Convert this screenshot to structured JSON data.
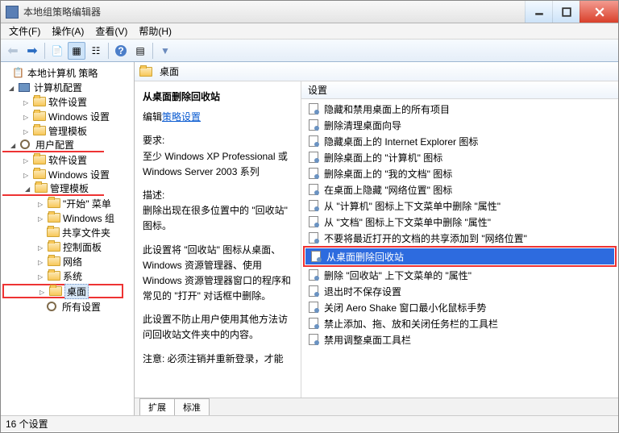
{
  "window": {
    "title": "本地组策略编辑器"
  },
  "menu": {
    "file": "文件(F)",
    "action": "操作(A)",
    "view": "查看(V)",
    "help": "帮助(H)"
  },
  "tree": {
    "root": "本地计算机 策略",
    "computer_cfg": "计算机配置",
    "c_software": "软件设置",
    "c_windows": "Windows 设置",
    "c_templates": "管理模板",
    "user_cfg": "用户配置",
    "u_software": "软件设置",
    "u_windows": "Windows 设置",
    "u_templates": "管理模板",
    "start_menu": "\"开始\" 菜单",
    "win_group": "Windows 组",
    "shared": "共享文件夹",
    "ctrl_panel": "控制面板",
    "network": "网络",
    "system": "系统",
    "desktop": "桌面",
    "all_settings": "所有设置"
  },
  "content": {
    "header": "桌面",
    "title": "从桌面删除回收站",
    "edit_prefix": "编辑",
    "edit_link": "策略设置",
    "req_label": "要求:",
    "req_text": "至少 Windows XP Professional 或 Windows Server 2003 系列",
    "desc_label": "描述:",
    "desc1": "删除出现在很多位置中的 \"回收站\" 图标。",
    "desc2": "此设置将 \"回收站\" 图标从桌面、Windows 资源管理器、使用 Windows 资源管理器窗口的程序和常见的 \"打开\" 对话框中删除。",
    "desc3": "此设置不防止用户使用其他方法访问回收站文件夹中的内容。",
    "desc4": "注意: 必须注销并重新登录，才能",
    "col_setting": "设置"
  },
  "policies": [
    "隐藏和禁用桌面上的所有项目",
    "删除清理桌面向导",
    "隐藏桌面上的 Internet Explorer 图标",
    "删除桌面上的 \"计算机\" 图标",
    "删除桌面上的 \"我的文档\" 图标",
    "在桌面上隐藏 \"网络位置\" 图标",
    "从 \"计算机\" 图标上下文菜单中删除 \"属性\"",
    "从 \"文档\" 图标上下文菜单中删除 \"属性\"",
    "不要将最近打开的文档的共享添加到 \"网络位置\"",
    "从桌面删除回收站",
    "删除 \"回收站\" 上下文菜单的 \"属性\"",
    "退出时不保存设置",
    "关闭 Aero Shake 窗口最小化鼠标手势",
    "禁止添加、拖、放和关闭任务栏的工具栏",
    "禁用调整桌面工具栏"
  ],
  "tabs": {
    "extended": "扩展",
    "standard": "标准"
  },
  "status": {
    "count": "16 个设置"
  }
}
